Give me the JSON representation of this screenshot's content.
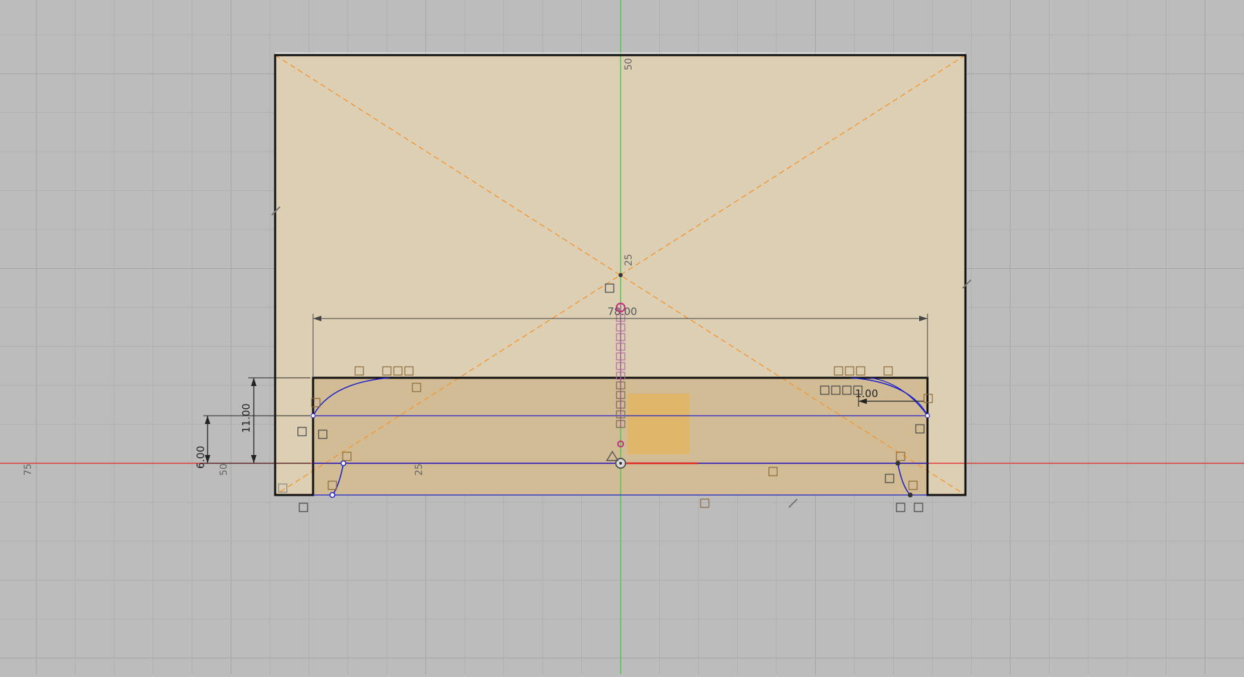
{
  "app": {
    "view": "sketch-canvas",
    "background_color": "#bcbcbc",
    "sketch_fill_color": "#dccfb4",
    "profile_fill_color": "#cfb891",
    "selection_fill_color": "#e4b460",
    "x_axis_color": "#e03a3a",
    "y_axis_color": "#4cc94c",
    "sketch_curve_color": "#1e20c8",
    "construction_line_color": "#f39a3a"
  },
  "ruler": {
    "left_75": "75",
    "left_50": "50",
    "bottom_25": "25",
    "axis_25": "25",
    "axis_50": "50"
  },
  "dimensions": {
    "width": "78.00",
    "height_outer": "11.00",
    "height_inner": "6.00",
    "offset": "1.00"
  },
  "icons": [
    "coincident-icon",
    "horizontal-constraint-icon",
    "parallel-constraint-icon",
    "tangent-constraint-icon",
    "sketch-origin-icon",
    "fix-constraint-icon"
  ]
}
